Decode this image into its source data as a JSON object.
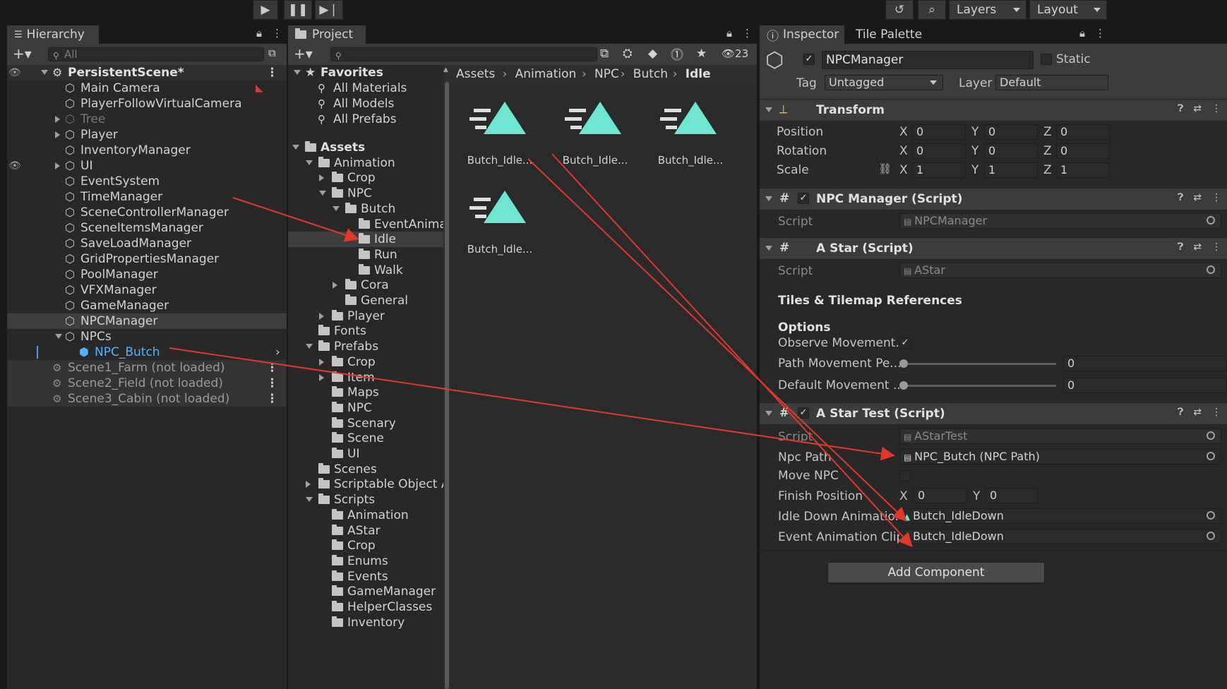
{
  "toolbar": {
    "layers_label": "Layers",
    "layout_label": "Layout"
  },
  "hierarchy": {
    "tab": "Hierarchy",
    "search_placeholder": "All",
    "scene": "PersistentScene*",
    "items": [
      {
        "label": "Main Camera"
      },
      {
        "label": "PlayerFollowVirtualCamera"
      },
      {
        "label": "Tree"
      },
      {
        "label": "Player"
      },
      {
        "label": "InventoryManager"
      },
      {
        "label": "UI"
      },
      {
        "label": "EventSystem"
      },
      {
        "label": "TimeManager"
      },
      {
        "label": "SceneControllerManager"
      },
      {
        "label": "SceneItemsManager"
      },
      {
        "label": "SaveLoadManager"
      },
      {
        "label": "GridPropertiesManager"
      },
      {
        "label": "PoolManager"
      },
      {
        "label": "VFXManager"
      },
      {
        "label": "GameManager"
      },
      {
        "label": "NPCManager"
      },
      {
        "label": "NPCs"
      },
      {
        "label": "NPC_Butch"
      }
    ],
    "unloaded_scenes": [
      "Scene1_Farm (not loaded)",
      "Scene2_Field (not loaded)",
      "Scene3_Cabin (not loaded)"
    ]
  },
  "project": {
    "tab": "Project",
    "hidden_count": "23",
    "favorites_label": "Favorites",
    "favorites": [
      "All Materials",
      "All Models",
      "All Prefabs"
    ],
    "tree": [
      {
        "label": "Assets"
      },
      {
        "label": "Animation"
      },
      {
        "label": "Crop"
      },
      {
        "label": "NPC"
      },
      {
        "label": "Butch"
      },
      {
        "label": "EventAnima"
      },
      {
        "label": "Idle"
      },
      {
        "label": "Run"
      },
      {
        "label": "Walk"
      },
      {
        "label": "Cora"
      },
      {
        "label": "General"
      },
      {
        "label": "Player"
      },
      {
        "label": "Fonts"
      },
      {
        "label": "Prefabs"
      },
      {
        "label": "Crop"
      },
      {
        "label": "Item"
      },
      {
        "label": "Maps"
      },
      {
        "label": "NPC"
      },
      {
        "label": "Scenary"
      },
      {
        "label": "Scene"
      },
      {
        "label": "UI"
      },
      {
        "label": "Scenes"
      },
      {
        "label": "Scriptable Object A"
      },
      {
        "label": "Scripts"
      },
      {
        "label": "Animation"
      },
      {
        "label": "AStar"
      },
      {
        "label": "Crop"
      },
      {
        "label": "Enums"
      },
      {
        "label": "Events"
      },
      {
        "label": "GameManager"
      },
      {
        "label": "HelperClasses"
      },
      {
        "label": "Inventory"
      }
    ],
    "breadcrumb": [
      "Assets",
      "Animation",
      "NPC",
      "Butch",
      "Idle"
    ],
    "assets": [
      "Butch_Idle...",
      "Butch_Idle...",
      "Butch_Idle...",
      "Butch_Idle..."
    ]
  },
  "inspector": {
    "tab": "Inspector",
    "tab2": "Tile Palette",
    "object_name": "NPCManager",
    "static_label": "Static",
    "tag_label": "Tag",
    "tag_value": "Untagged",
    "layer_label": "Layer",
    "layer_value": "Default",
    "transform": {
      "title": "Transform",
      "position_label": "Position",
      "rotation_label": "Rotation",
      "scale_label": "Scale",
      "x": "X",
      "y": "Y",
      "z": "Z",
      "position": [
        "0",
        "0",
        "0"
      ],
      "rotation": [
        "0",
        "0",
        "0"
      ],
      "scale": [
        "1",
        "1",
        "1"
      ]
    },
    "npc_manager": {
      "title": "NPC Manager (Script)",
      "script_label": "Script",
      "script_value": "NPCManager"
    },
    "astar": {
      "title": "A Star (Script)",
      "script_label": "Script",
      "script_value": "AStar",
      "section1": "Tiles & Tilemap References",
      "section2": "Options",
      "observe_label": "Observe Movement...",
      "path_label": "Path Movement Pe...",
      "path_value": "0",
      "default_label": "Default Movement ...",
      "default_value": "0"
    },
    "astar_test": {
      "title": "A Star Test (Script)",
      "script_label": "Script",
      "script_value": "AStarTest",
      "npc_path_label": "Npc Path",
      "npc_path_value": "NPC_Butch (NPC Path)",
      "move_npc_label": "Move NPC",
      "finish_label": "Finish Position",
      "finish_x": "0",
      "finish_y": "0",
      "idle_label": "Idle Down Animatio...",
      "idle_value": "Butch_IdleDown",
      "event_label": "Event Animation Clip",
      "event_value": "Butch_IdleDown"
    },
    "add_component": "Add Component"
  },
  "colors": {
    "accent": "#4c9bff",
    "arrow": "#e0392a",
    "anim_icon": "#6ee6d2"
  }
}
